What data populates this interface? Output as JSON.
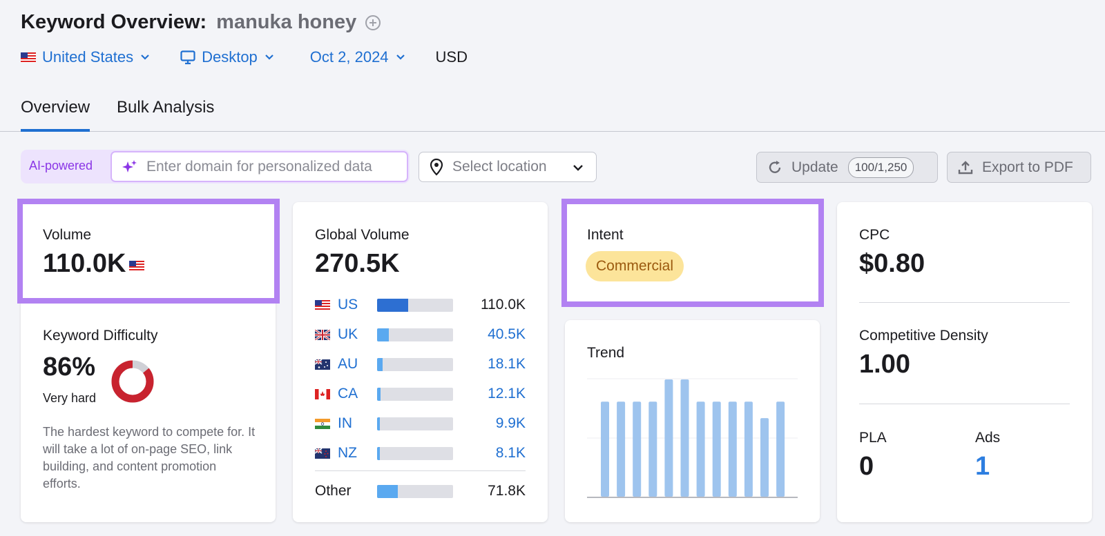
{
  "header": {
    "title": "Keyword Overview:",
    "keyword": "manuka honey"
  },
  "filters": {
    "country": "United States",
    "device": "Desktop",
    "date": "Oct 2, 2024",
    "currency": "USD"
  },
  "tabs": [
    {
      "label": "Overview",
      "active": true
    },
    {
      "label": "Bulk Analysis",
      "active": false
    }
  ],
  "toolbar": {
    "ai_label": "AI-powered",
    "domain_placeholder": "Enter domain for personalized data",
    "location_placeholder": "Select location",
    "update_label": "Update",
    "update_count": "100/1,250",
    "export_label": "Export to PDF"
  },
  "volume": {
    "label": "Volume",
    "value": "110.0K"
  },
  "difficulty": {
    "label": "Keyword Difficulty",
    "value": "86%",
    "level": "Very hard",
    "percent": 86,
    "description": "The hardest keyword to compete for. It will take a lot of on-page SEO, link building, and content promotion efforts."
  },
  "global_volume": {
    "label": "Global Volume",
    "value": "270.5K",
    "rows": [
      {
        "code": "US",
        "value": "110.0K",
        "share": 0.41
      },
      {
        "code": "UK",
        "value": "40.5K",
        "share": 0.15
      },
      {
        "code": "AU",
        "value": "18.1K",
        "share": 0.07
      },
      {
        "code": "CA",
        "value": "12.1K",
        "share": 0.045
      },
      {
        "code": "IN",
        "value": "9.9K",
        "share": 0.04
      },
      {
        "code": "NZ",
        "value": "8.1K",
        "share": 0.035
      }
    ],
    "other": {
      "label": "Other",
      "value": "71.8K",
      "share": 0.27
    }
  },
  "intent": {
    "label": "Intent",
    "value": "Commercial"
  },
  "trend": {
    "label": "Trend",
    "values": [
      0.81,
      0.81,
      0.81,
      0.81,
      1.0,
      1.0,
      0.81,
      0.81,
      0.81,
      0.81,
      0.67,
      0.81
    ]
  },
  "cpc": {
    "label": "CPC",
    "value": "$0.80"
  },
  "density": {
    "label": "Competitive Density",
    "value": "1.00"
  },
  "pla": {
    "label": "PLA",
    "value": "0"
  },
  "ads": {
    "label": "Ads",
    "value": "1"
  },
  "colors": {
    "accent": "#1f6fd1",
    "highlight": "#b282f2",
    "difficulty_red": "#c8232f",
    "intent_bg": "#fce49a",
    "trend_bar": "#9ec4ee",
    "us_bar": "#2d6fd2",
    "bar_light": "#5aa9f0"
  }
}
